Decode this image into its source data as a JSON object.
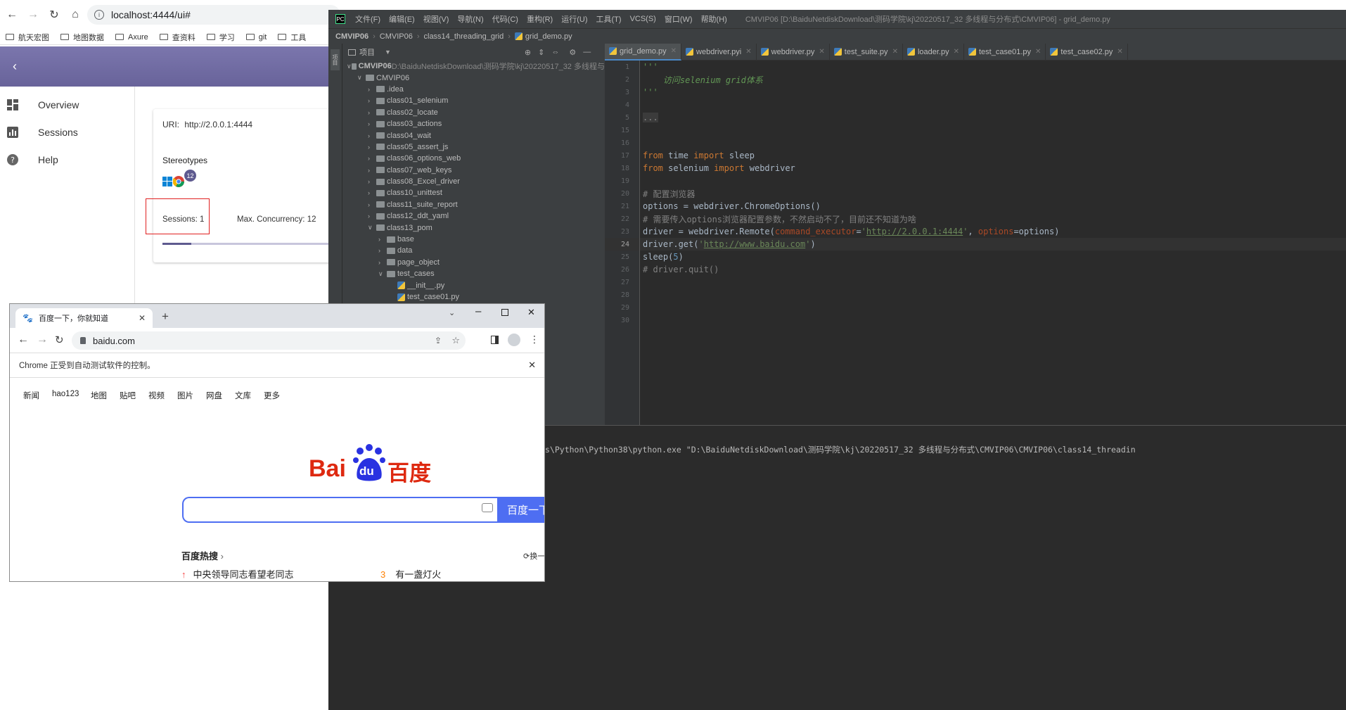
{
  "back_browser": {
    "url": "localhost:4444/ui#",
    "info_glyph": "i",
    "bookmarks": [
      "航天宏图",
      "地图数据",
      "Axure",
      "查资料",
      "学习",
      "git",
      "工具"
    ]
  },
  "grid": {
    "back_glyph": "‹",
    "sidebar": [
      "Overview",
      "Sessions",
      "Help"
    ],
    "uri_label": "URI:",
    "uri_value": "http://2.0.0.1:4444",
    "stereotypes_title": "Stereotypes",
    "badge_count": "12",
    "sessions_label": "Sessions: 1",
    "max_concurrency": "Max. Concurrency: 12",
    "progress": 0.17,
    "accent": "#6f6a9e",
    "highlight": "#e02020"
  },
  "pycharm": {
    "logo": "PC",
    "menu": [
      "文件(F)",
      "编辑(E)",
      "视图(V)",
      "导航(N)",
      "代码(C)",
      "重构(R)",
      "运行(U)",
      "工具(T)",
      "VCS(S)",
      "窗口(W)",
      "帮助(H)"
    ],
    "title": "CMVIP06 [D:\\BaiduNetdiskDownload\\测码学院\\kj\\20220517_32 多线程与分布式\\CMVIP06] - grid_demo.py",
    "breadcrumb": [
      "CMVIP06",
      "CMVIP06",
      "class14_threading_grid",
      "grid_demo.py"
    ],
    "project_label": "项目",
    "stripe_label": "项目",
    "tree": [
      {
        "depth": 0,
        "type": "folder",
        "open": true,
        "name": "CMVIP06",
        "extra": "D:\\BaiduNetdiskDownload\\测码学院\\kj\\20220517_32 多线程与"
      },
      {
        "depth": 1,
        "type": "folder",
        "open": true,
        "name": "CMVIP06"
      },
      {
        "depth": 2,
        "type": "folder",
        "open": false,
        "name": ".idea"
      },
      {
        "depth": 2,
        "type": "folder",
        "open": false,
        "name": "class01_selenium"
      },
      {
        "depth": 2,
        "type": "folder",
        "open": false,
        "name": "class02_locate"
      },
      {
        "depth": 2,
        "type": "folder",
        "open": false,
        "name": "class03_actions"
      },
      {
        "depth": 2,
        "type": "folder",
        "open": false,
        "name": "class04_wait"
      },
      {
        "depth": 2,
        "type": "folder",
        "open": false,
        "name": "class05_assert_js"
      },
      {
        "depth": 2,
        "type": "folder",
        "open": false,
        "name": "class06_options_web"
      },
      {
        "depth": 2,
        "type": "folder",
        "open": false,
        "name": "class07_web_keys"
      },
      {
        "depth": 2,
        "type": "folder",
        "open": false,
        "name": "class08_Excel_driver"
      },
      {
        "depth": 2,
        "type": "folder",
        "open": false,
        "name": "class10_unittest"
      },
      {
        "depth": 2,
        "type": "folder",
        "open": false,
        "name": "class11_suite_report"
      },
      {
        "depth": 2,
        "type": "folder",
        "open": false,
        "name": "class12_ddt_yaml"
      },
      {
        "depth": 2,
        "type": "folder",
        "open": true,
        "name": "class13_pom"
      },
      {
        "depth": 3,
        "type": "folder",
        "open": false,
        "name": "base"
      },
      {
        "depth": 3,
        "type": "folder",
        "open": false,
        "name": "data"
      },
      {
        "depth": 3,
        "type": "folder",
        "open": false,
        "name": "page_object"
      },
      {
        "depth": 3,
        "type": "folder",
        "open": true,
        "name": "test_cases"
      },
      {
        "depth": 4,
        "type": "py",
        "name": "__init__.py"
      },
      {
        "depth": 4,
        "type": "py",
        "name": "test_case01.py"
      }
    ],
    "tabs": [
      "grid_demo.py",
      "webdriver.pyi",
      "webdriver.py",
      "test_suite.py",
      "loader.py",
      "test_case01.py",
      "test_case02.py"
    ],
    "line_numbers": [
      "1",
      "2",
      "3",
      "4",
      "5",
      "15",
      "16",
      "17",
      "18",
      "19",
      "20",
      "21",
      "22",
      "23",
      "24",
      "25",
      "26",
      "27",
      "28",
      "29",
      "30"
    ],
    "active_line": "24",
    "console_line": "s\\Python\\Python38\\python.exe \"D:\\BaiduNetdiskDownload\\测码学院\\kj\\20220517_32 多线程与分布式\\CMVIP06\\CMVIP06\\class14_threadin"
  },
  "front_chrome": {
    "tab_title": "百度一下，你就知道",
    "url": "baidu.com",
    "info_bar": "Chrome 正受到自动测试软件的控制。",
    "nav": [
      "新闻",
      "hao123",
      "地图",
      "贴吧",
      "视频",
      "图片",
      "网盘",
      "文库",
      "更多"
    ],
    "logo_bai": "Bai",
    "logo_du": "du",
    "logo_cn": "百度",
    "search_button": "百度一下",
    "hot_title": "百度热搜",
    "hot_refresh": "换一",
    "hot_items": [
      {
        "rank": "↑",
        "text": "中央领导同志看望老同志"
      },
      {
        "rank": "3",
        "text": "有一盏灯火"
      }
    ]
  }
}
